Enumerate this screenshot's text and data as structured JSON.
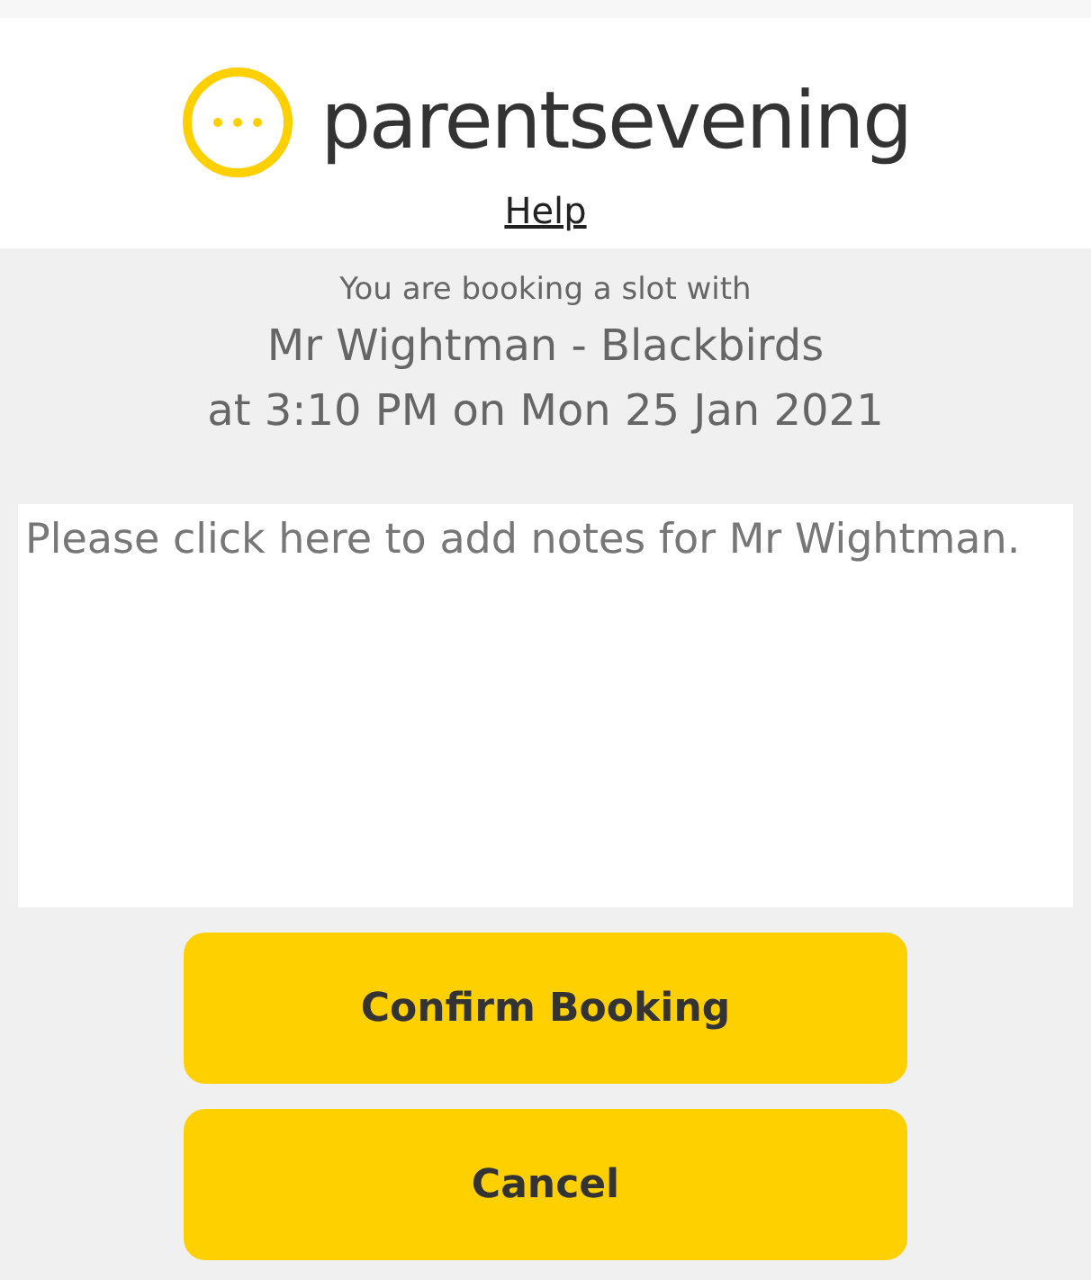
{
  "header": {
    "brand": "parentsevening",
    "help_link": "Help"
  },
  "booking": {
    "intro": "You are booking a slot with",
    "teacher": "Mr Wightman - Blackbirds",
    "time": "at 3:10 PM on Mon 25 Jan 2021"
  },
  "notes": {
    "placeholder": "Please click here to add notes for Mr Wightman."
  },
  "buttons": [
    "Confirm Booking",
    "Cancel"
  ]
}
